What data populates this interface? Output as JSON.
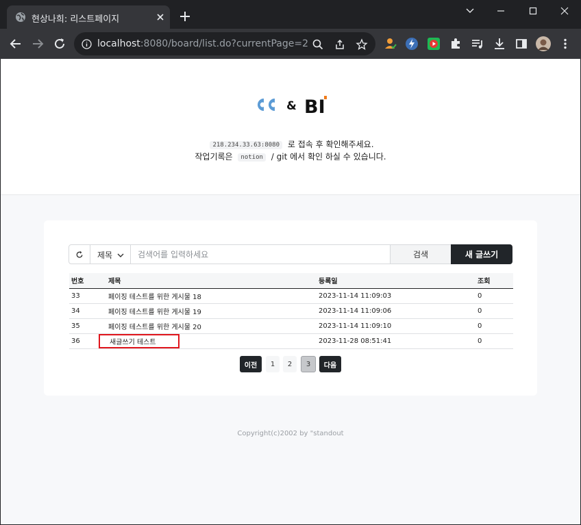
{
  "browser": {
    "tab_title": "현상나희: 리스트페이지",
    "url_host": "localhost",
    "url_rest": ":8080/board/list.do?currentPage=2"
  },
  "header": {
    "logo_amp": "&",
    "logo_text": "BI",
    "line1_chip": "218.234.33.63:8080",
    "line1_text": "로 접속 후 확인해주세요.",
    "line2_prefix": "작업기록은",
    "line2_chip": "notion",
    "line2_suffix": "/ git 에서 확인 하실 수 있습니다."
  },
  "search": {
    "select_value": "제목",
    "placeholder": "검색어를 입력하세요",
    "search_label": "검색",
    "write_label": "새 글쓰기"
  },
  "table": {
    "headers": [
      "번호",
      "제목",
      "등록일",
      "조회"
    ],
    "rows": [
      {
        "no": "33",
        "title": "페이징 테스트를 위한 게시물 18",
        "date": "2023-11-14 11:09:03",
        "views": "0"
      },
      {
        "no": "34",
        "title": "페이징 테스트를 위한 게시물 19",
        "date": "2023-11-14 11:09:06",
        "views": "0"
      },
      {
        "no": "35",
        "title": "페이징 테스트를 위한 게시물 20",
        "date": "2023-11-14 11:09:10",
        "views": "0"
      },
      {
        "no": "36",
        "title": "새글쓰기 테스트",
        "date": "2023-11-28 08:51:41",
        "views": "0"
      }
    ]
  },
  "pagination": {
    "prev": "이전",
    "pages": [
      "1",
      "2",
      "3"
    ],
    "current": "3",
    "next": "다음"
  },
  "footer": {
    "copyright": "Copyright(c)2002 by \"standout"
  },
  "colors": {
    "accent_dark": "#212529",
    "highlight_red": "#e0141b",
    "logo_blue": "#5b9bd5",
    "logo_orange": "#f07c1b"
  }
}
